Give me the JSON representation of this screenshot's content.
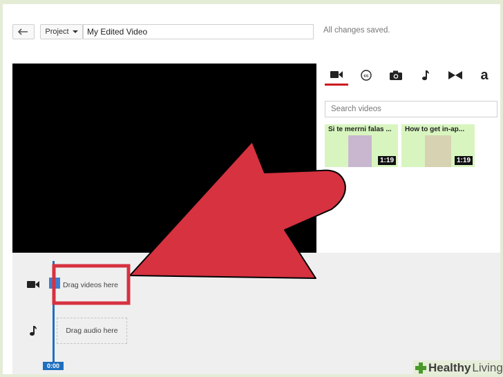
{
  "toolbar": {
    "back_icon": "undo-arrow-icon",
    "project_label": "Project",
    "project_caret_icon": "caret-down-icon",
    "title_value": "My Edited Video",
    "status": "All changes saved."
  },
  "tools": {
    "tabs": [
      {
        "icon": "video-camera-icon",
        "active": true
      },
      {
        "icon": "closed-captions-icon"
      },
      {
        "icon": "photo-camera-icon"
      },
      {
        "icon": "music-note-icon"
      },
      {
        "icon": "transitions-icon"
      },
      {
        "icon": "text-icon",
        "glyph": "a"
      }
    ],
    "search_placeholder": "Search videos",
    "videos": [
      {
        "title": "Si te merrni falas ...",
        "duration": "1:19"
      },
      {
        "title": "How to get in-ap...",
        "duration": "1:19"
      }
    ]
  },
  "timeline": {
    "video_track_icon": "video-camera-icon",
    "video_drop_label": "Drag videos here",
    "audio_track_icon": "music-note-icon",
    "audio_drop_label": "Drag audio here",
    "playhead_time": "0:00"
  },
  "annotation": {
    "color": "#d63240",
    "arrow": "arrow-pointer",
    "highlight": "highlight-box"
  },
  "watermark": {
    "brand": "Healthy",
    "brand2": "Living"
  }
}
